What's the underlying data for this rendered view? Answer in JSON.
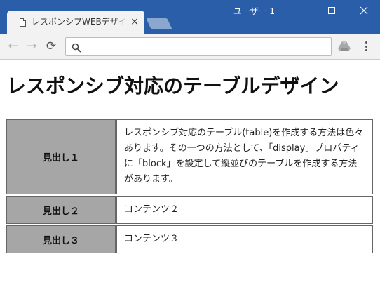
{
  "window": {
    "user": "ユーザー 1",
    "minimize_label": "—",
    "maximize_label": "",
    "close_label": "✕"
  },
  "tab": {
    "title": "レスポンシブWEBデザイン入門",
    "close_label": "×"
  },
  "toolbar": {
    "back_label": "←",
    "forward_label": "→",
    "reload_label": "⟳",
    "search_value": ""
  },
  "page": {
    "title": "レスポンシブ対応のテーブルデザイン",
    "table": {
      "rows": [
        {
          "header": "見出し１",
          "content": "レスポンシブ対応のテーブル(table)を作成する方法は色々あります。その一つの方法として、「display」プロパティに「block」を設定して縦並びのテーブルを作成する方法があります。"
        },
        {
          "header": "見出し２",
          "content": "コンテンツ２"
        },
        {
          "header": "見出し３",
          "content": "コンテンツ３"
        }
      ]
    }
  },
  "colors": {
    "titlebar": "#2b5ea8",
    "toolbar": "#f2f2f2",
    "table_header_bg": "#a6a6a6",
    "table_border": "#666666"
  }
}
